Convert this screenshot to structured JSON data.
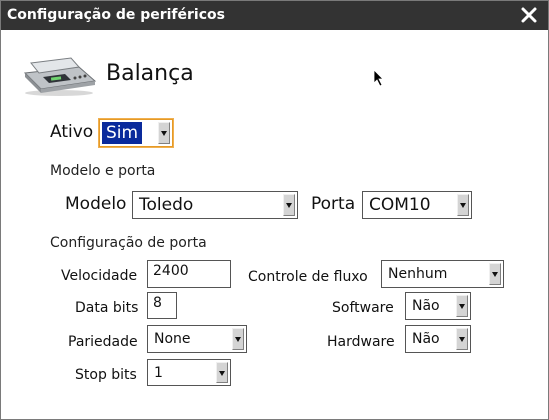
{
  "window": {
    "title": "Configuração de periféricos",
    "close_icon": "close-icon"
  },
  "header": {
    "icon": "scale-icon",
    "title": "Balança"
  },
  "active": {
    "label": "Ativo",
    "value": "Sim"
  },
  "model_port": {
    "section": "Modelo e porta",
    "model_label": "Modelo",
    "model_value": "Toledo",
    "port_label": "Porta",
    "port_value": "COM10"
  },
  "port_config": {
    "section": "Configuração de porta",
    "speed_label": "Velocidade",
    "speed_value": "2400",
    "databits_label": "Data bits",
    "databits_value": "8",
    "parity_label": "Pariedade",
    "parity_value": "None",
    "stopbits_label": "Stop bits",
    "stopbits_value": "1",
    "flow_label": "Controle de fluxo",
    "flow_value": "Nenhum",
    "software_label": "Software",
    "software_value": "Não",
    "hardware_label": "Hardware",
    "hardware_value": "Não"
  },
  "colors": {
    "titlebar": "#333333",
    "selection": "#0a2a9c",
    "focus": "#e69a26"
  }
}
